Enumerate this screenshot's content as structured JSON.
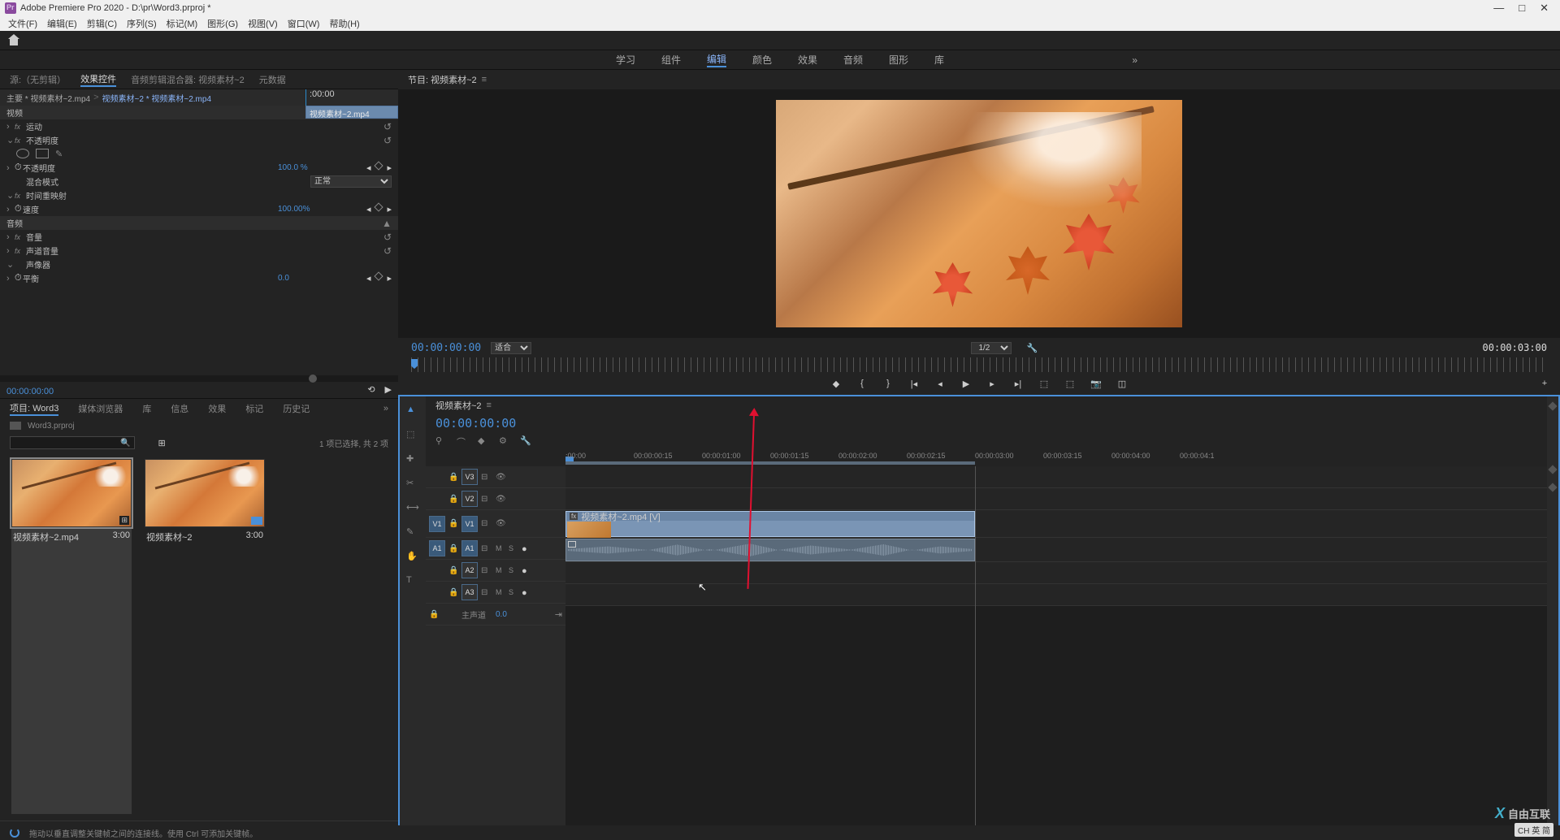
{
  "app": {
    "title": "Adobe Premiere Pro 2020 - D:\\pr\\Word3.prproj *",
    "window_controls": {
      "min": "—",
      "max": "□",
      "close": "✕"
    }
  },
  "menu": [
    "文件(F)",
    "编辑(E)",
    "剪辑(C)",
    "序列(S)",
    "标记(M)",
    "图形(G)",
    "视图(V)",
    "窗口(W)",
    "帮助(H)"
  ],
  "workspaces": {
    "items": [
      "学习",
      "组件",
      "编辑",
      "颜色",
      "效果",
      "音频",
      "图形",
      "库"
    ],
    "active_index": 2,
    "overflow": "»"
  },
  "source_panel": {
    "tabs": [
      "源:（无剪辑）",
      "效果控件",
      "音频剪辑混合器: 视频素材~2",
      "元数据"
    ],
    "active_index": 1
  },
  "effect_controls": {
    "master_clip": "主要 * 视频素材~2.mp4",
    "clip": "视频素材~2 * 视频素材~2.mp4",
    "timeline_start": ":00:00",
    "clip_label": "视频素材~2.mp4",
    "video_section": "视频",
    "motion": "运动",
    "opacity_section": "不透明度",
    "opacity_label": "不透明度",
    "opacity_value": "100.0 %",
    "blend_label": "混合模式",
    "blend_value": "正常",
    "time_remap": "时间重映射",
    "speed_label": "速度",
    "speed_value": "100.00%",
    "audio_section": "音频",
    "volume": "音量",
    "channel_volume": "声道音量",
    "panner": "声像器",
    "balance_label": "平衡",
    "balance_value": "0.0",
    "timecode": "00:00:00:00"
  },
  "project": {
    "tabs": [
      "项目: Word3",
      "媒体浏览器",
      "库",
      "信息",
      "效果",
      "标记",
      "历史记"
    ],
    "active_index": 0,
    "more": "»",
    "path": "Word3.prproj",
    "search_placeholder": "",
    "item_info": "1 项已选择, 共 2 项",
    "items": [
      {
        "name": "视频素材~2.mp4",
        "duration": "3:00",
        "type": "clip",
        "selected": true
      },
      {
        "name": "视频素材~2",
        "duration": "3:00",
        "type": "sequence",
        "selected": false
      }
    ]
  },
  "program": {
    "title": "节目: 视频素材~2",
    "timecode": "00:00:00:00",
    "fit": "适合",
    "quality": "1/2",
    "duration": "00:00:03:00"
  },
  "timeline": {
    "title": "视频素材~2",
    "timecode": "00:00:00:00",
    "ruler": [
      ":00:00",
      "00:00:00:15",
      "00:00:01:00",
      "00:00:01:15",
      "00:00:02:00",
      "00:00:02:15",
      "00:00:03:00",
      "00:00:03:15",
      "00:00:04:00",
      "00:00:04:1"
    ],
    "tracks": {
      "v3": "V3",
      "v2": "V2",
      "v1": "V1",
      "a1": "A1",
      "a2": "A2",
      "a3": "A3",
      "src_v1": "V1",
      "src_a1": "A1",
      "m": "M",
      "s": "S",
      "master": "主声道",
      "master_level": "0.0"
    },
    "clip": {
      "name": "视频素材~2.mp4 [V]",
      "fx": "fx"
    }
  },
  "status": {
    "hint": "拖动以垂直调整关键帧之间的连接线。使用 Ctrl 可添加关键帧。"
  },
  "watermark": {
    "brand": "自由互联"
  },
  "ime": "CH 英 简"
}
